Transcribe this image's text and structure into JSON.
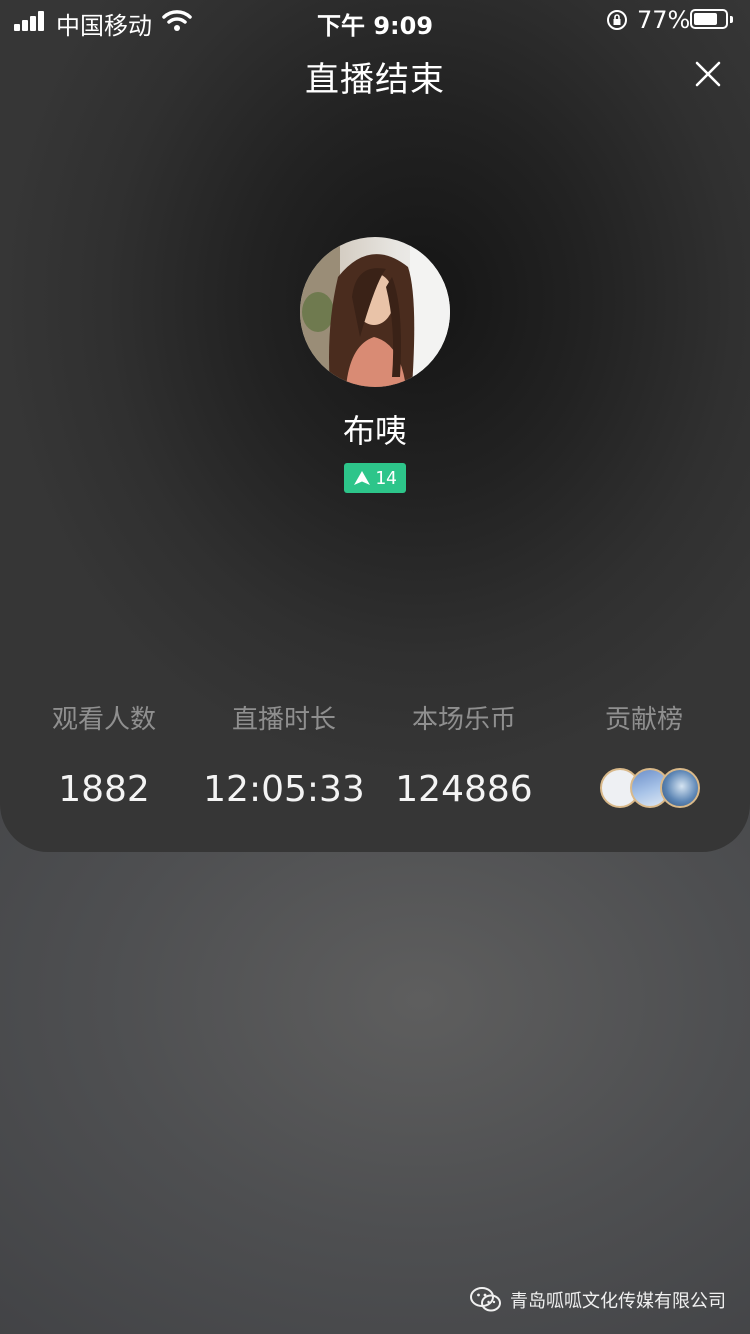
{
  "status_bar": {
    "carrier": "中国移动",
    "time": "下午 9:09",
    "battery_percent": "77%",
    "battery_level": 0.77
  },
  "header": {
    "title": "直播结束",
    "close_icon": "close-icon"
  },
  "profile": {
    "username": "布咦",
    "level": "14",
    "level_icon": "level-arrow-icon",
    "badge_color": "#2dc58a"
  },
  "stats": [
    {
      "label": "观看人数",
      "value": "1882"
    },
    {
      "label": "直播时长",
      "value": "12:05:33"
    },
    {
      "label": "本场乐币",
      "value": "124886"
    },
    {
      "label": "贡献榜",
      "value": ""
    }
  ],
  "watermark": {
    "text": "青岛呱呱文化传媒有限公司",
    "icon": "wechat-icon"
  }
}
